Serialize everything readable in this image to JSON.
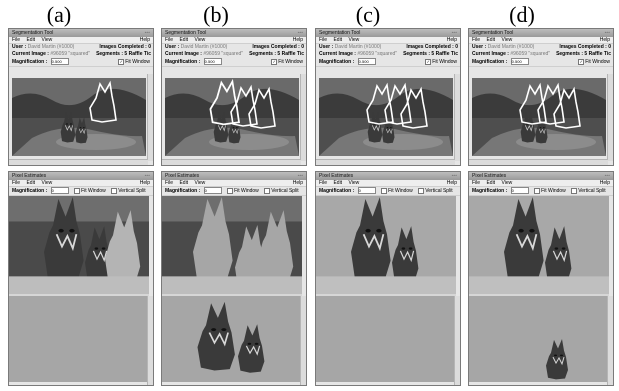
{
  "panels": [
    {
      "label": "(a)",
      "outline_mode": "a",
      "est_top": "a",
      "est_bottom": "a"
    },
    {
      "label": "(b)",
      "outline_mode": "b",
      "est_top": "b",
      "est_bottom": "b"
    },
    {
      "label": "(c)",
      "outline_mode": "c",
      "est_top": "c",
      "est_bottom": "c"
    },
    {
      "label": "(d)",
      "outline_mode": "d",
      "est_top": "d",
      "est_bottom": "d"
    }
  ],
  "top_window": {
    "title": "Segmentation Tool",
    "window_buttons": "◦◦◦",
    "menu": [
      "File",
      "Edit",
      "View"
    ],
    "help": "Help",
    "user_label": "User :",
    "user_value": "David Martin (#1000)",
    "images_completed": "Images Completed : 0",
    "current_image_label": "Current Image :",
    "current_image_value": "#96059 \"squared\"",
    "segments": "Segments : 5",
    "raffle": "Raffle Tic",
    "magnification_label": "Magnification :",
    "magnification_value": "0.500",
    "fit_window": "Fit Window"
  },
  "bottom_window": {
    "title": "Pixel Estimates",
    "window_buttons": "◦◦◦",
    "menu": [
      "File",
      "Edit",
      "View"
    ],
    "help": "Help",
    "magnification_label": "Magnification :",
    "magnification_value": "0",
    "fit_window": "Fit Window",
    "vertical_split": "Vertical Split"
  },
  "colors": {
    "window_bg": "#e6e6e6",
    "titlebar": "#a8a8a8",
    "outline": "#ffffff",
    "image_gray": "#8f8f8f"
  }
}
